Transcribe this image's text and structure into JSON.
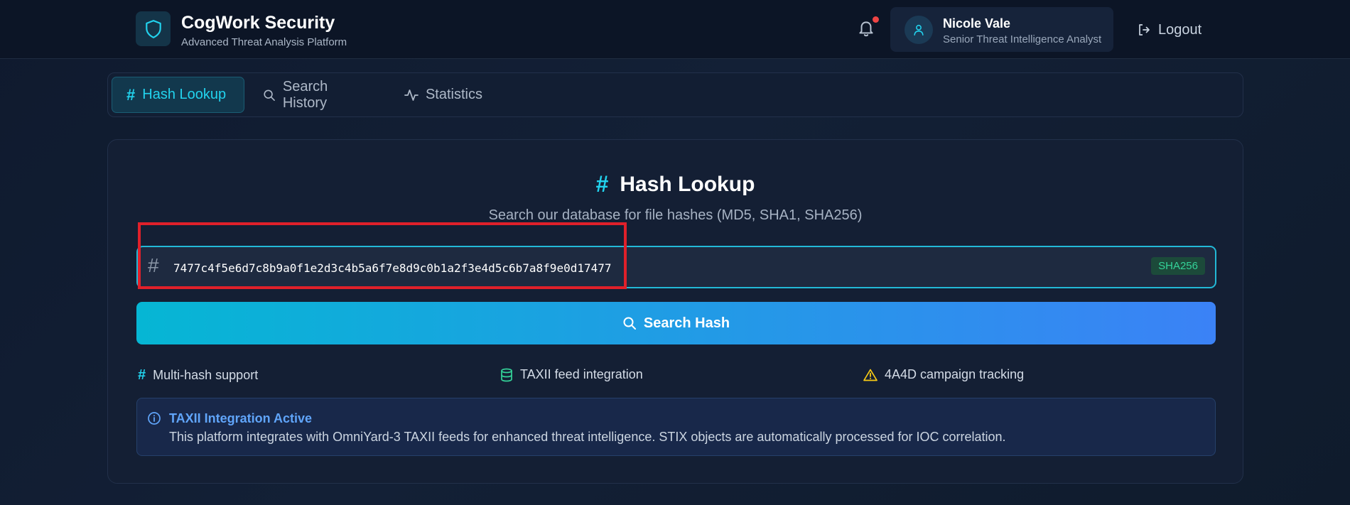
{
  "header": {
    "app_title": "CogWork Security",
    "app_subtitle": "Advanced Threat Analysis Platform",
    "notification_dot_color": "#ef4444",
    "user": {
      "name": "Nicole Vale",
      "role": "Senior Threat Intelligence Analyst"
    },
    "logout_label": "Logout"
  },
  "tabs": [
    {
      "label": "Hash Lookup",
      "icon": "hash-icon",
      "active": true
    },
    {
      "label": "Search History",
      "icon": "search-icon",
      "active": false
    },
    {
      "label": "Statistics",
      "icon": "activity-icon",
      "active": false
    }
  ],
  "main": {
    "title": "Hash Lookup",
    "subtitle": "Search our database for file hashes (MD5, SHA1, SHA256)",
    "hash_input": {
      "value": "7477c4f5e6d7c8b9a0f1e2d3c4b5a6f7e8d9c0b1a2f3e4d5c6b7a8f9e0d17477",
      "detected_type": "SHA256"
    },
    "search_button_label": "Search Hash",
    "features": [
      {
        "label": "Multi-hash support",
        "icon": "hash-icon"
      },
      {
        "label": "TAXII feed integration",
        "icon": "database-icon"
      },
      {
        "label": "4A4D campaign tracking",
        "icon": "warning-icon"
      }
    ],
    "info": {
      "title": "TAXII Integration Active",
      "text": "This platform integrates with OmniYard-3 TAXII feeds for enhanced threat intelligence. STIX objects are automatically processed for IOC correlation."
    }
  },
  "colors": {
    "accent": "#22d3ee",
    "button_gradient_start": "#06b6d4",
    "button_gradient_end": "#3b82f6",
    "highlight_box": "#e0202a"
  }
}
